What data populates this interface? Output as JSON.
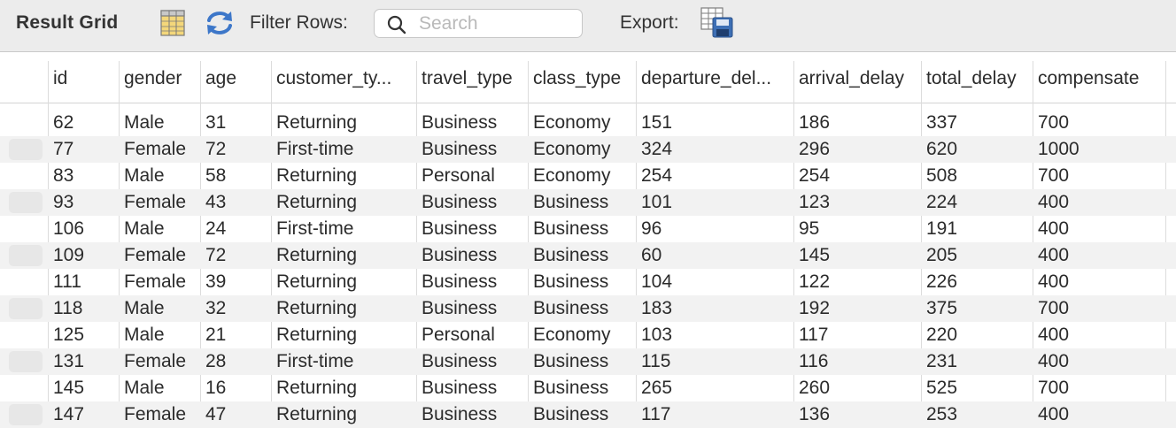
{
  "toolbar": {
    "title": "Result Grid",
    "filter_label": "Filter Rows:",
    "search_placeholder": "Search",
    "export_label": "Export:"
  },
  "icons": {
    "form_editor": "grid-columns-icon",
    "refresh": "refresh-icon",
    "search": "magnifier-icon",
    "export": "export-save-icon"
  },
  "grid": {
    "columns": [
      "id",
      "gender",
      "age",
      "customer_ty...",
      "travel_type",
      "class_type",
      "departure_del...",
      "arrival_delay",
      "total_delay",
      "compensate"
    ],
    "rows": [
      [
        "62",
        "Male",
        "31",
        "Returning",
        "Business",
        "Economy",
        "151",
        "186",
        "337",
        "700"
      ],
      [
        "77",
        "Female",
        "72",
        "First-time",
        "Business",
        "Economy",
        "324",
        "296",
        "620",
        "1000"
      ],
      [
        "83",
        "Male",
        "58",
        "Returning",
        "Personal",
        "Economy",
        "254",
        "254",
        "508",
        "700"
      ],
      [
        "93",
        "Female",
        "43",
        "Returning",
        "Business",
        "Business",
        "101",
        "123",
        "224",
        "400"
      ],
      [
        "106",
        "Male",
        "24",
        "First-time",
        "Business",
        "Business",
        "96",
        "95",
        "191",
        "400"
      ],
      [
        "109",
        "Female",
        "72",
        "Returning",
        "Business",
        "Business",
        "60",
        "145",
        "205",
        "400"
      ],
      [
        "111",
        "Female",
        "39",
        "Returning",
        "Business",
        "Business",
        "104",
        "122",
        "226",
        "400"
      ],
      [
        "118",
        "Male",
        "32",
        "Returning",
        "Business",
        "Business",
        "183",
        "192",
        "375",
        "700"
      ],
      [
        "125",
        "Male",
        "21",
        "Returning",
        "Personal",
        "Economy",
        "103",
        "117",
        "220",
        "400"
      ],
      [
        "131",
        "Female",
        "28",
        "First-time",
        "Business",
        "Business",
        "115",
        "116",
        "231",
        "400"
      ],
      [
        "145",
        "Male",
        "16",
        "Returning",
        "Business",
        "Business",
        "265",
        "260",
        "525",
        "700"
      ],
      [
        "147",
        "Female",
        "47",
        "Returning",
        "Business",
        "Business",
        "117",
        "136",
        "253",
        "400"
      ]
    ]
  },
  "colors": {
    "toolbar_bg": "#ececec",
    "row_alt_bg": "#f2f2f2",
    "grid_line": "#dcdcdc"
  }
}
